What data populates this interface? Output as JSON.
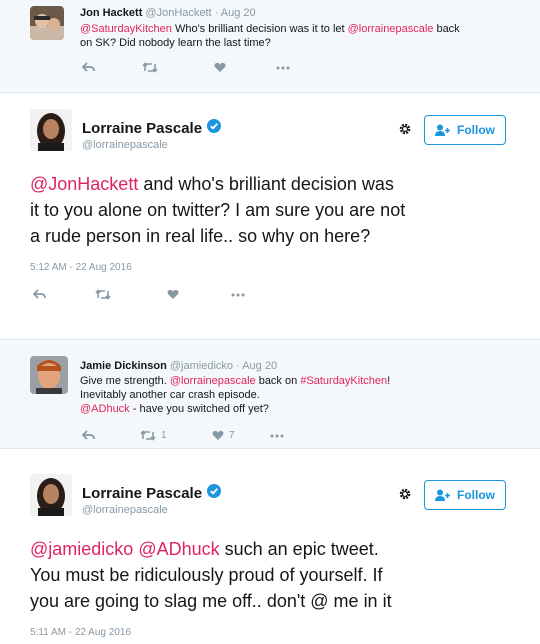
{
  "tweet1": {
    "name": "Jon Hackett",
    "handle": "@JonHackett",
    "time": "· Aug 20",
    "mention": "@SaturdayKitchen",
    "text_line1": " Who's brilliant decision was it to let ",
    "mention2": "@lorrainepascale",
    "text_line1_end": " back",
    "text_line2": "on SK?  Did nobody learn the last time?",
    "actions": [
      "reply-icon",
      "retweet-icon",
      "like-icon",
      "more-icon"
    ]
  },
  "tweet2": {
    "name": "Lorraine Pascale",
    "handle": "@lorrainepascale",
    "follow_label": "Follow",
    "mention": "@JonHackett",
    "line1_rest": " and  who's brilliant decision was",
    "line2": "it to you alone on twitter? I am sure you are not",
    "line3": "a rude person in real life.. so why on here?",
    "timestamp": "5:12 AM - 22 Aug 2016"
  },
  "tweet3": {
    "name": "Jamie Dickinson",
    "handle": "@jamiedicko",
    "time": "· Aug 20",
    "line1_a": "Give me strength. ",
    "line1_mention": "@lorrainepascale",
    "line1_b": " back on ",
    "line1_tag": "#SaturdayKitchen",
    "line1_c": "!",
    "line2": "Inevitably another car crash episode.",
    "line3_mention": "@ADhuck",
    "line3_rest": " - have you switched off yet?",
    "retweet_count": "1",
    "like_count": "7"
  },
  "tweet4": {
    "name": "Lorraine Pascale",
    "handle": "@lorrainepascale",
    "follow_label": "Follow",
    "mention1": "@jamiedicko",
    "mention2": "@ADhuck",
    "line1_rest": " such an epic tweet.",
    "line2": "You must be ridiculously proud of yourself. If",
    "line3": "you are going to slag me off.. don't @ me in it",
    "timestamp": "5:11 AM - 22 Aug 2016"
  },
  "colors": {
    "accent": "#1b95e0",
    "mention": "#e0245e",
    "muted": "#8899a6",
    "reply_bg": "#f5f8fa"
  }
}
